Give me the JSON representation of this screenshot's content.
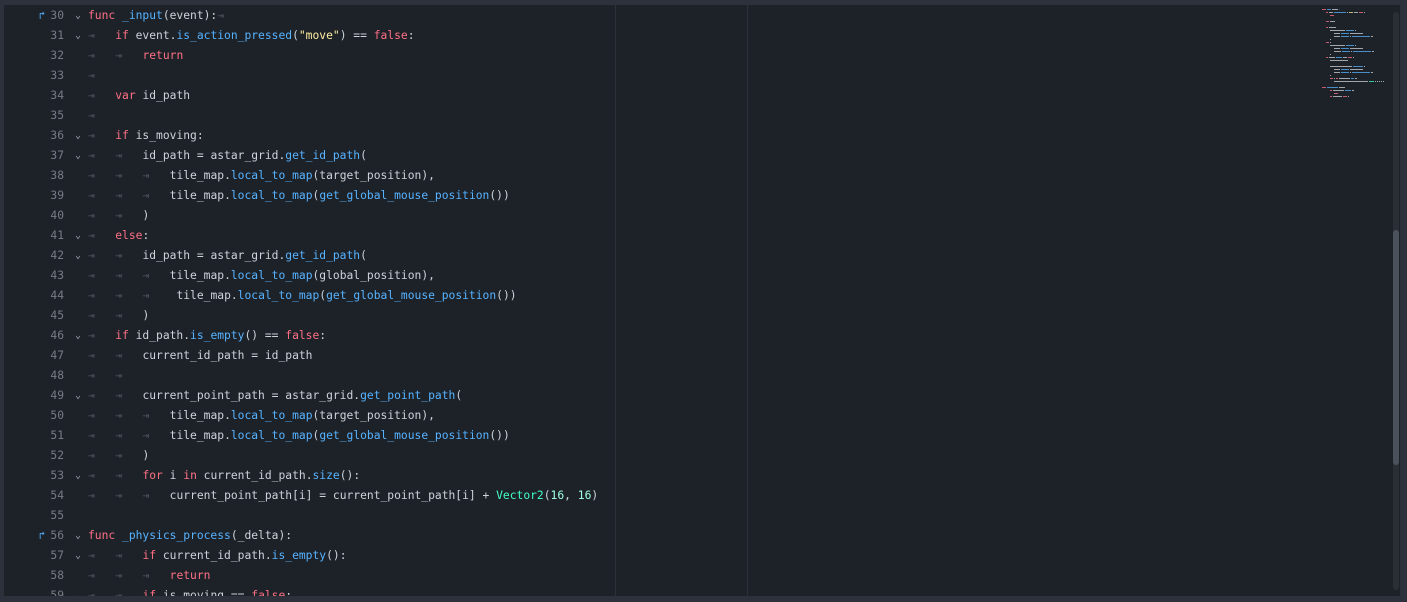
{
  "editor": {
    "lines": [
      {
        "num": "30",
        "fold": true,
        "override": true,
        "indent": 0,
        "tokens": [
          [
            "kw",
            "func "
          ],
          [
            "fn",
            "_input"
          ],
          [
            "plain",
            "(event):"
          ],
          [
            "tabend",
            "⇥"
          ]
        ]
      },
      {
        "num": "31",
        "fold": true,
        "indent": 1,
        "tokens": [
          [
            "kw",
            "if "
          ],
          [
            "plain",
            "event."
          ],
          [
            "fn",
            "is_action_pressed"
          ],
          [
            "plain",
            "("
          ],
          [
            "str",
            "\"move\""
          ],
          [
            "plain",
            ") == "
          ],
          [
            "kw",
            "false"
          ],
          [
            "plain",
            ":"
          ]
        ]
      },
      {
        "num": "32",
        "indent": 2,
        "tokens": [
          [
            "kw",
            "return"
          ]
        ]
      },
      {
        "num": "33",
        "indent": 1,
        "tokens": []
      },
      {
        "num": "34",
        "indent": 1,
        "tokens": [
          [
            "kw",
            "var "
          ],
          [
            "plain",
            "id_path"
          ]
        ]
      },
      {
        "num": "35",
        "indent": 1,
        "tokens": []
      },
      {
        "num": "36",
        "fold": true,
        "indent": 1,
        "tokens": [
          [
            "kw",
            "if "
          ],
          [
            "plain",
            "is_moving:"
          ]
        ]
      },
      {
        "num": "37",
        "fold": true,
        "indent": 2,
        "tokens": [
          [
            "plain",
            "id_path = astar_grid."
          ],
          [
            "fn",
            "get_id_path"
          ],
          [
            "plain",
            "("
          ]
        ]
      },
      {
        "num": "38",
        "indent": 3,
        "tokens": [
          [
            "plain",
            "tile_map."
          ],
          [
            "fn",
            "local_to_map"
          ],
          [
            "plain",
            "(target_position),"
          ]
        ]
      },
      {
        "num": "39",
        "indent": 3,
        "tokens": [
          [
            "plain",
            "tile_map."
          ],
          [
            "fn",
            "local_to_map"
          ],
          [
            "plain",
            "("
          ],
          [
            "fn",
            "get_global_mouse_position"
          ],
          [
            "plain",
            "())"
          ]
        ]
      },
      {
        "num": "40",
        "indent": 2,
        "tokens": [
          [
            "plain",
            ")"
          ]
        ]
      },
      {
        "num": "41",
        "fold": true,
        "indent": 1,
        "tokens": [
          [
            "kw",
            "else"
          ],
          [
            "plain",
            ":"
          ]
        ]
      },
      {
        "num": "42",
        "fold": true,
        "indent": 2,
        "tokens": [
          [
            "plain",
            "id_path = astar_grid."
          ],
          [
            "fn",
            "get_id_path"
          ],
          [
            "plain",
            "("
          ]
        ]
      },
      {
        "num": "43",
        "indent": 3,
        "tokens": [
          [
            "plain",
            "tile_map."
          ],
          [
            "fn",
            "local_to_map"
          ],
          [
            "plain",
            "(global_position),"
          ]
        ]
      },
      {
        "num": "44",
        "indent": 3,
        "tokens": [
          [
            "plain",
            " tile_map."
          ],
          [
            "fn",
            "local_to_map"
          ],
          [
            "plain",
            "("
          ],
          [
            "fn",
            "get_global_mouse_position"
          ],
          [
            "plain",
            "())"
          ]
        ]
      },
      {
        "num": "45",
        "indent": 2,
        "tokens": [
          [
            "plain",
            ")"
          ]
        ]
      },
      {
        "num": "46",
        "fold": true,
        "indent": 1,
        "tokens": [
          [
            "kw",
            "if "
          ],
          [
            "plain",
            "id_path."
          ],
          [
            "fn",
            "is_empty"
          ],
          [
            "plain",
            "() == "
          ],
          [
            "kw",
            "false"
          ],
          [
            "plain",
            ":"
          ]
        ]
      },
      {
        "num": "47",
        "indent": 2,
        "tokens": [
          [
            "plain",
            "current_id_path = id_path"
          ]
        ]
      },
      {
        "num": "48",
        "indent": 2,
        "tokens": []
      },
      {
        "num": "49",
        "fold": true,
        "indent": 2,
        "tokens": [
          [
            "plain",
            "current_point_path = astar_grid."
          ],
          [
            "fn",
            "get_point_path"
          ],
          [
            "plain",
            "("
          ]
        ]
      },
      {
        "num": "50",
        "indent": 3,
        "tokens": [
          [
            "plain",
            "tile_map."
          ],
          [
            "fn",
            "local_to_map"
          ],
          [
            "plain",
            "(target_position),"
          ]
        ]
      },
      {
        "num": "51",
        "indent": 3,
        "tokens": [
          [
            "plain",
            "tile_map."
          ],
          [
            "fn",
            "local_to_map"
          ],
          [
            "plain",
            "("
          ],
          [
            "fn",
            "get_global_mouse_position"
          ],
          [
            "plain",
            "())"
          ]
        ]
      },
      {
        "num": "52",
        "indent": 2,
        "tokens": [
          [
            "plain",
            ")"
          ]
        ]
      },
      {
        "num": "53",
        "fold": true,
        "indent": 2,
        "tokens": [
          [
            "kw",
            "for "
          ],
          [
            "plain",
            "i "
          ],
          [
            "kw",
            "in "
          ],
          [
            "plain",
            "current_id_path."
          ],
          [
            "fn",
            "size"
          ],
          [
            "plain",
            "():"
          ]
        ]
      },
      {
        "num": "54",
        "indent": 3,
        "tokens": [
          [
            "plain",
            "current_point_path[i] = current_point_path[i] + "
          ],
          [
            "type",
            "Vector2"
          ],
          [
            "plain",
            "("
          ],
          [
            "num",
            "16"
          ],
          [
            "plain",
            ", "
          ],
          [
            "num",
            "16"
          ],
          [
            "plain",
            ")"
          ]
        ]
      },
      {
        "num": "55",
        "indent": 0,
        "tokens": []
      },
      {
        "num": "56",
        "fold": true,
        "override": true,
        "indent": 0,
        "tokens": [
          [
            "kw",
            "func "
          ],
          [
            "fn",
            "_physics_process"
          ],
          [
            "plain",
            "(_delta):"
          ]
        ]
      },
      {
        "num": "57",
        "fold": true,
        "indent": 2,
        "tokens": [
          [
            "kw",
            "if "
          ],
          [
            "plain",
            "current_id_path."
          ],
          [
            "fn",
            "is_empty"
          ],
          [
            "plain",
            "():"
          ]
        ]
      },
      {
        "num": "58",
        "indent": 3,
        "tokens": [
          [
            "kw",
            "return"
          ]
        ]
      },
      {
        "num": "59",
        "fold": true,
        "indent": 2,
        "tokens": [
          [
            "kw",
            "if "
          ],
          [
            "plain",
            "is_moving == "
          ],
          [
            "kw",
            "false"
          ],
          [
            "plain",
            ":"
          ]
        ]
      }
    ],
    "icons": {
      "fold": "chevron-down-icon",
      "override": "override-arrow-icon",
      "tab": "tab-indent-icon"
    },
    "glyphs": {
      "fold": "⌄",
      "override": "↱",
      "tab": "⇥"
    },
    "colors": {
      "background": "#1d2229",
      "keyword": "#ff7085",
      "function": "#57b3ff",
      "string": "#ffeda1",
      "number": "#a1ffe0",
      "type": "#42ffc2",
      "text": "#cdd3da",
      "line_number": "#767c86"
    }
  }
}
